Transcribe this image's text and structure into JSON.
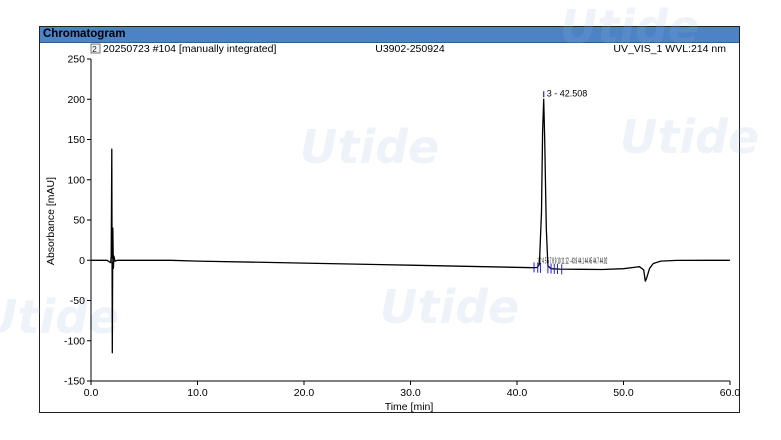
{
  "window": {
    "title": "Chromatogram"
  },
  "header": {
    "injection": "20250723 #104 [manually integrated]",
    "sample": "U3902-250924",
    "channel": "UV_VIS_1 WVL:214 nm"
  },
  "watermark": "Utide",
  "colors": {
    "title_bar": "#4c83c6",
    "trace": "#000000",
    "peak_marker": "#1f1fd0"
  },
  "icons": {
    "header": "chromatogram-document-icon"
  },
  "chart_data": {
    "type": "line",
    "title": "Chromatogram",
    "xlabel": "Time [min]",
    "ylabel": "Absorbance [mAU]",
    "xlim": [
      0,
      60
    ],
    "ylim": [
      -150,
      250
    ],
    "x_ticks": [
      0,
      10,
      20,
      30,
      40,
      50,
      60
    ],
    "x_tick_labels": [
      "0.0",
      "10.0",
      "20.0",
      "30.0",
      "40.0",
      "50.0",
      "60.0"
    ],
    "y_ticks": [
      -150,
      -100,
      -50,
      0,
      50,
      100,
      150,
      200,
      250
    ],
    "y_tick_labels": [
      "-150",
      "-100",
      "-50",
      "0",
      "50",
      "100",
      "150",
      "200",
      "250"
    ],
    "grid": false,
    "series": [
      {
        "x": [
          0,
          1.5,
          1.85,
          1.9,
          1.95,
          2.0,
          2.05,
          2.1,
          2.15,
          2.25,
          2.5,
          5,
          7.5,
          10,
          20,
          30,
          41.5,
          41.9,
          42.1,
          42.3,
          42.4,
          42.508,
          42.6,
          42.75,
          42.9,
          43.2,
          44,
          46,
          48,
          50,
          51.5,
          51.9,
          52.05,
          52.2,
          52.45,
          52.8,
          53.5,
          55,
          58,
          60
        ],
        "y": [
          0,
          0,
          -3,
          5,
          138,
          -115,
          40,
          -10,
          5,
          -1,
          0,
          0,
          0,
          -1,
          -3.6,
          -6.2,
          -9.2,
          -9.0,
          -5,
          60,
          160,
          200,
          150,
          40,
          -7,
          -10.5,
          -11,
          -11.2,
          -11.5,
          -10.5,
          -8,
          -12,
          -26,
          -21,
          -10,
          -4,
          -1,
          -0.2,
          0,
          0
        ]
      }
    ],
    "peaks": [
      {
        "number": 3,
        "time": 42.508,
        "label": "3 - 42.508"
      }
    ],
    "baseline_markers": [
      41.6,
      41.95,
      42.2,
      42.9,
      43.2,
      43.5,
      43.8,
      44.2
    ],
    "peak_label_cluster": "1 2 4 5 6 7 8 9 10 11 12 - 43.9 44.1 44.45 44.7 44.92"
  }
}
